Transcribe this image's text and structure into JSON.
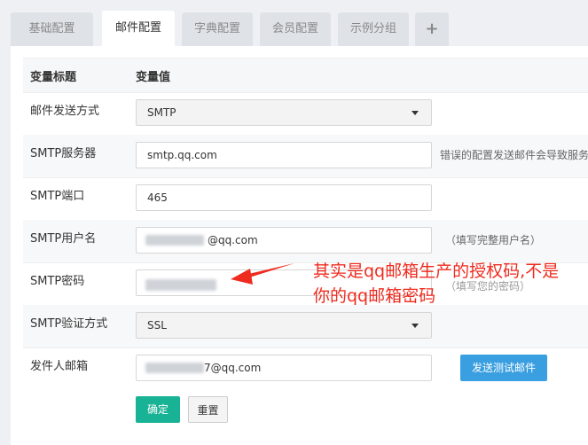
{
  "tabs": [
    {
      "label": "基础配置",
      "active": false
    },
    {
      "label": "邮件配置",
      "active": true
    },
    {
      "label": "字典配置",
      "active": false
    },
    {
      "label": "会员配置",
      "active": false
    },
    {
      "label": "示例分组",
      "active": false
    },
    {
      "label": "+",
      "active": false
    }
  ],
  "table": {
    "header_title": "变量标题",
    "header_value": "变量值"
  },
  "rows": {
    "send_method": {
      "label": "邮件发送方式",
      "value": "SMTP"
    },
    "smtp_server": {
      "label": "SMTP服务器",
      "value": "smtp.qq.com",
      "hint": "错误的配置发送邮件会导致服务"
    },
    "smtp_port": {
      "label": "SMTP端口",
      "value": "465"
    },
    "smtp_user": {
      "label": "SMTP用户名",
      "value_suffix": "@qq.com",
      "hint": "（填写完整用户名）"
    },
    "smtp_password": {
      "label": "SMTP密码",
      "hint": "（填写您的密码）"
    },
    "smtp_verify": {
      "label": "SMTP验证方式",
      "value": "SSL"
    },
    "sender": {
      "label": "发件人邮箱",
      "value_suffix": "7@qq.com",
      "test_button": "发送测试邮件"
    }
  },
  "actions": {
    "confirm": "确定",
    "reset": "重置"
  },
  "annotation": {
    "line1": "其实是qq邮箱生产的授权码,不是",
    "line2": "你的qq邮箱密码"
  },
  "colors": {
    "accent_blue": "#3a9fe0",
    "confirm_green": "#18b294",
    "annotation_red": "#ef2b1f"
  }
}
